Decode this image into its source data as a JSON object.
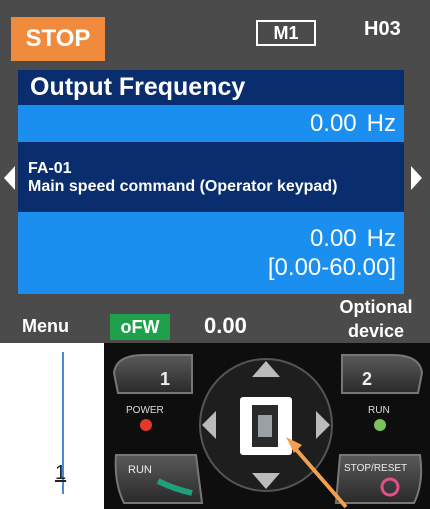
{
  "status": {
    "state": "STOP",
    "mode": "M1",
    "code": "H03"
  },
  "monitor": {
    "title": "Output Frequency",
    "value": "0.00",
    "unit": "Hz"
  },
  "parameter": {
    "code": "FA-01",
    "name": "Main speed command (Operator keypad)",
    "value": "0.00",
    "unit": "Hz",
    "range": "[0.00-60.00]"
  },
  "footer": {
    "menu_label": "Menu",
    "direction_badge": "oFW",
    "frequency": "0.00",
    "optional_line1": "Optional",
    "optional_line2": "device"
  },
  "step": {
    "number": "1"
  },
  "keypad": {
    "key1_label": "1",
    "key2_label": "2",
    "power_label": "POWER",
    "run_label": "RUN",
    "run_led_label": "RUN",
    "stop_reset_label": "STOP/RESET"
  },
  "colors": {
    "stop_badge": "#f08a3c",
    "header_blue": "#0a2d6e",
    "value_blue": "#1a8ff0",
    "ofw_green": "#1fa04a",
    "pointer_arrow": "#f0a050"
  }
}
